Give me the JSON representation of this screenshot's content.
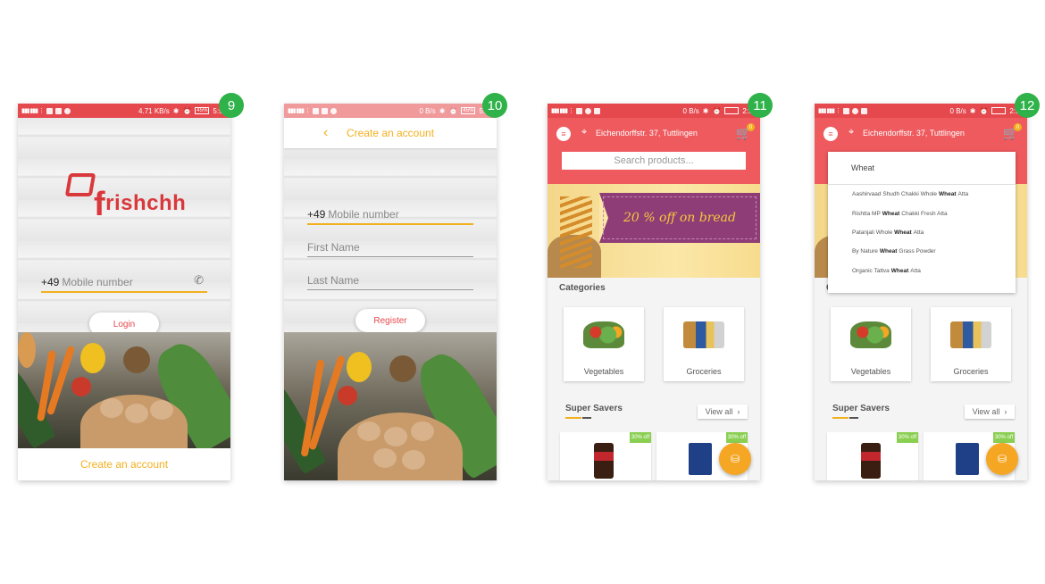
{
  "badges": [
    "9",
    "10",
    "11",
    "12"
  ],
  "status": {
    "speed1": "4.71 KB/s",
    "battery1": "45%",
    "time1": "5:58",
    "speed2": "0 B/s",
    "battery2": "45%",
    "time2": "5:58",
    "speed3": "0 B/s",
    "time3": "2:55",
    "speed4": "0 B/s",
    "time4": "2:55"
  },
  "screen1": {
    "logo": "rishchh",
    "country_code": "+49",
    "mobile_placeholder": "Mobile number",
    "login_label": "Login",
    "create_account_label": "Create an account"
  },
  "screen2": {
    "title": "Create an account",
    "country_code": "+49",
    "mobile_placeholder": "Mobile number",
    "first_name_placeholder": "First Name",
    "last_name_placeholder": "Last Name",
    "register_label": "Register"
  },
  "screen3": {
    "address": "Eichendorffstr. 37, Tuttlingen",
    "cart_count": "0",
    "search_placeholder": "Search products...",
    "banner_text": "20 % off on bread",
    "categories_title": "Categories",
    "categories": [
      "Vegetables",
      "Groceries"
    ],
    "super_savers_title": "Super Savers",
    "view_all_label": "View all",
    "offers": [
      "30% off",
      "30% off"
    ]
  },
  "screen4": {
    "address": "Eichendorffstr. 37, Tuttlingen",
    "cart_count": "0",
    "search_value": "Wheat",
    "categories_letter": "C",
    "suggestions": [
      {
        "pre": "Aashirvaad Shudh Chakki Whole",
        "hit": "Wheat",
        "post": "Atta"
      },
      {
        "pre": "Rishtta MP",
        "hit": "Wheat",
        "post": "Chakki Fresh Atta"
      },
      {
        "pre": "Patanjali Whole",
        "hit": "Wheat",
        "post": "Atta"
      },
      {
        "pre": "By Nature",
        "hit": "Wheat",
        "post": "Grass Powder"
      },
      {
        "pre": "Organic Tattva",
        "hit": "Wheat",
        "post": "Atta"
      }
    ],
    "categories": [
      "Vegetables",
      "Groceries"
    ],
    "super_savers_title": "Super Savers",
    "view_all_label": "View all",
    "offers": [
      "30% off",
      "30% off"
    ]
  },
  "colors": {
    "red": "#ee5a5e",
    "yellow": "#f2b01e",
    "purple": "#8e3d76",
    "green": "#2fb24a"
  }
}
